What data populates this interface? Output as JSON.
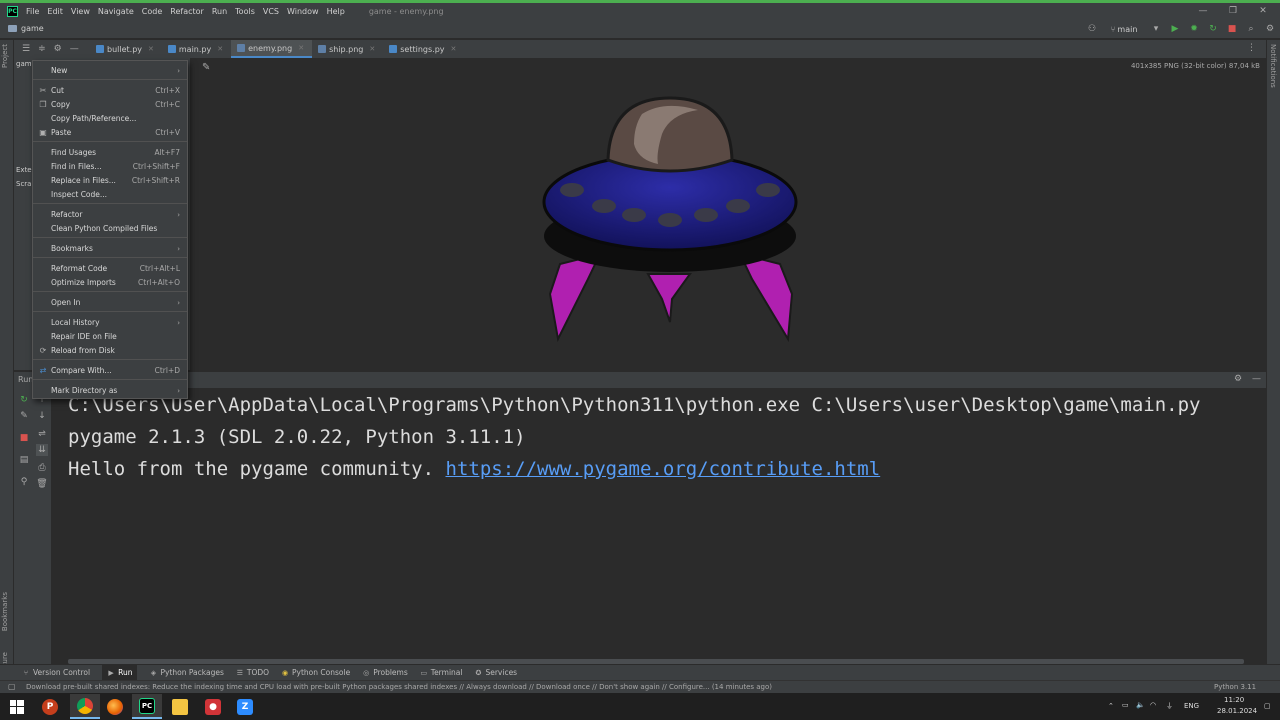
{
  "menubar": {
    "app_icon": "PC",
    "items": [
      "File",
      "Edit",
      "View",
      "Navigate",
      "Code",
      "Refactor",
      "Run",
      "Tools",
      "VCS",
      "Window",
      "Help"
    ],
    "window_title": "game - enemy.png"
  },
  "titlebar": {
    "project": "game",
    "branch": "main"
  },
  "tabs": [
    {
      "label": "bullet.py",
      "icon": "python-file-icon",
      "color": "#4a88c7",
      "active": false
    },
    {
      "label": "main.py",
      "icon": "python-file-icon",
      "color": "#4a88c7",
      "active": false
    },
    {
      "label": "enemy.png",
      "icon": "image-file-icon",
      "color": "#5e7fa6",
      "active": true
    },
    {
      "label": "ship.png",
      "icon": "image-file-icon",
      "color": "#5e7fa6",
      "active": false
    },
    {
      "label": "settings.py",
      "icon": "python-file-icon",
      "color": "#4a88c7",
      "active": false
    }
  ],
  "viewer": {
    "image_info": "401x385 PNG (32-bit color) 87,04 kB"
  },
  "left_stripe": {
    "project_label": "Project",
    "bookmarks_label": "Bookmarks",
    "structure_label": "Structure"
  },
  "right_stripe": {
    "notifications_label": "Notifications"
  },
  "project_panel": {
    "partial_items": [
      "gam",
      "Exte",
      "Scra"
    ]
  },
  "context_menu": {
    "items": [
      {
        "label": "New",
        "submenu": true
      },
      {
        "label": "Cut",
        "shortcut": "Ctrl+X",
        "icon": "scissors-icon"
      },
      {
        "label": "Copy",
        "shortcut": "Ctrl+C",
        "icon": "copy-icon"
      },
      {
        "label": "Copy Path/Reference..."
      },
      {
        "label": "Paste",
        "shortcut": "Ctrl+V",
        "icon": "paste-icon"
      },
      {
        "label": "Find Usages",
        "shortcut": "Alt+F7"
      },
      {
        "label": "Find in Files...",
        "shortcut": "Ctrl+Shift+F"
      },
      {
        "label": "Replace in Files...",
        "shortcut": "Ctrl+Shift+R"
      },
      {
        "label": "Inspect Code..."
      },
      {
        "label": "Refactor",
        "submenu": true
      },
      {
        "label": "Clean Python Compiled Files"
      },
      {
        "label": "Bookmarks",
        "submenu": true
      },
      {
        "label": "Reformat Code",
        "shortcut": "Ctrl+Alt+L"
      },
      {
        "label": "Optimize Imports",
        "shortcut": "Ctrl+Alt+O"
      },
      {
        "label": "Open In",
        "submenu": true
      },
      {
        "label": "Local History",
        "submenu": true
      },
      {
        "label": "Repair IDE on File"
      },
      {
        "label": "Reload from Disk",
        "icon": "reload-icon"
      },
      {
        "label": "Compare With...",
        "shortcut": "Ctrl+D",
        "icon": "compare-icon"
      },
      {
        "label": "Mark Directory as",
        "submenu": true
      }
    ]
  },
  "run_panel": {
    "label": "Run",
    "console_lines": [
      "C:\\Users\\User\\AppData\\Local\\Programs\\Python\\Python311\\python.exe C:\\Users\\user\\Desktop\\game\\main.py",
      "pygame 2.1.3 (SDL 2.0.22, Python 3.11.1)",
      "Hello from the pygame community. "
    ],
    "link": "https://www.pygame.org/contribute.html"
  },
  "toolstrip": [
    {
      "label": "Version Control",
      "icon": "branch-icon",
      "active": false
    },
    {
      "label": "Run",
      "icon": "play-icon",
      "active": true
    },
    {
      "label": "Python Packages",
      "icon": "packages-icon",
      "active": false
    },
    {
      "label": "TODO",
      "icon": "list-icon",
      "active": false
    },
    {
      "label": "Python Console",
      "icon": "python-console-icon",
      "active": false
    },
    {
      "label": "Problems",
      "icon": "problems-icon",
      "active": false
    },
    {
      "label": "Terminal",
      "icon": "terminal-icon",
      "active": false
    },
    {
      "label": "Services",
      "icon": "services-icon",
      "active": false
    }
  ],
  "statusbar": {
    "message": "Download pre-built shared indexes: Reduce the indexing time and CPU load with pre-built Python packages shared indexes // Always download // Download once // Don't show again // Configure... (14 minutes ago)",
    "interpreter": "Python 3.11"
  },
  "taskbar": {
    "apps": [
      {
        "name": "windows-start-icon",
        "glyph": "",
        "color": "#1f1f1f"
      },
      {
        "name": "powerpoint-icon",
        "glyph": "P",
        "color": "#c43e1c"
      },
      {
        "name": "chrome-icon",
        "glyph": "",
        "color": "#4caf50"
      },
      {
        "name": "firefox-icon",
        "glyph": "",
        "color": "#e66000"
      },
      {
        "name": "pycharm-icon",
        "glyph": "PC",
        "color": "#000000"
      },
      {
        "name": "file-explorer-icon",
        "glyph": "",
        "color": "#f4c542"
      },
      {
        "name": "recorder-icon",
        "glyph": "",
        "color": "#d13438"
      },
      {
        "name": "zoom-icon",
        "glyph": "Z",
        "color": "#2d8cff"
      }
    ],
    "lang": "ENG",
    "time": "11:20",
    "date": "28.01.2024"
  },
  "colors": {
    "accent": "#4a88c7",
    "link": "#589df6",
    "ufo_body": "#1a1a7a",
    "ufo_dome": "#5a4a44",
    "ufo_legs": "#b020b0"
  }
}
